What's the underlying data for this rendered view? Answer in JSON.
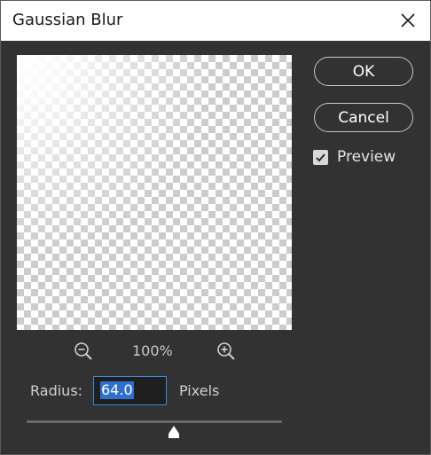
{
  "window": {
    "title": "Gaussian Blur",
    "close_icon": "close-icon"
  },
  "buttons": {
    "ok_label": "OK",
    "cancel_label": "Cancel"
  },
  "preview": {
    "checkbox_label": "Preview",
    "checked": true
  },
  "zoom": {
    "level": "100%",
    "zoom_out_icon": "zoom-out-icon",
    "zoom_in_icon": "zoom-in-icon"
  },
  "radius": {
    "label": "Radius:",
    "value": "64.0",
    "units": "Pixels"
  },
  "slider": {
    "position_fraction": 0.575
  },
  "colors": {
    "background": "#323232",
    "titlebar": "#ffffff",
    "accent": "#3b8ad6",
    "selection": "#2f6fd0"
  }
}
